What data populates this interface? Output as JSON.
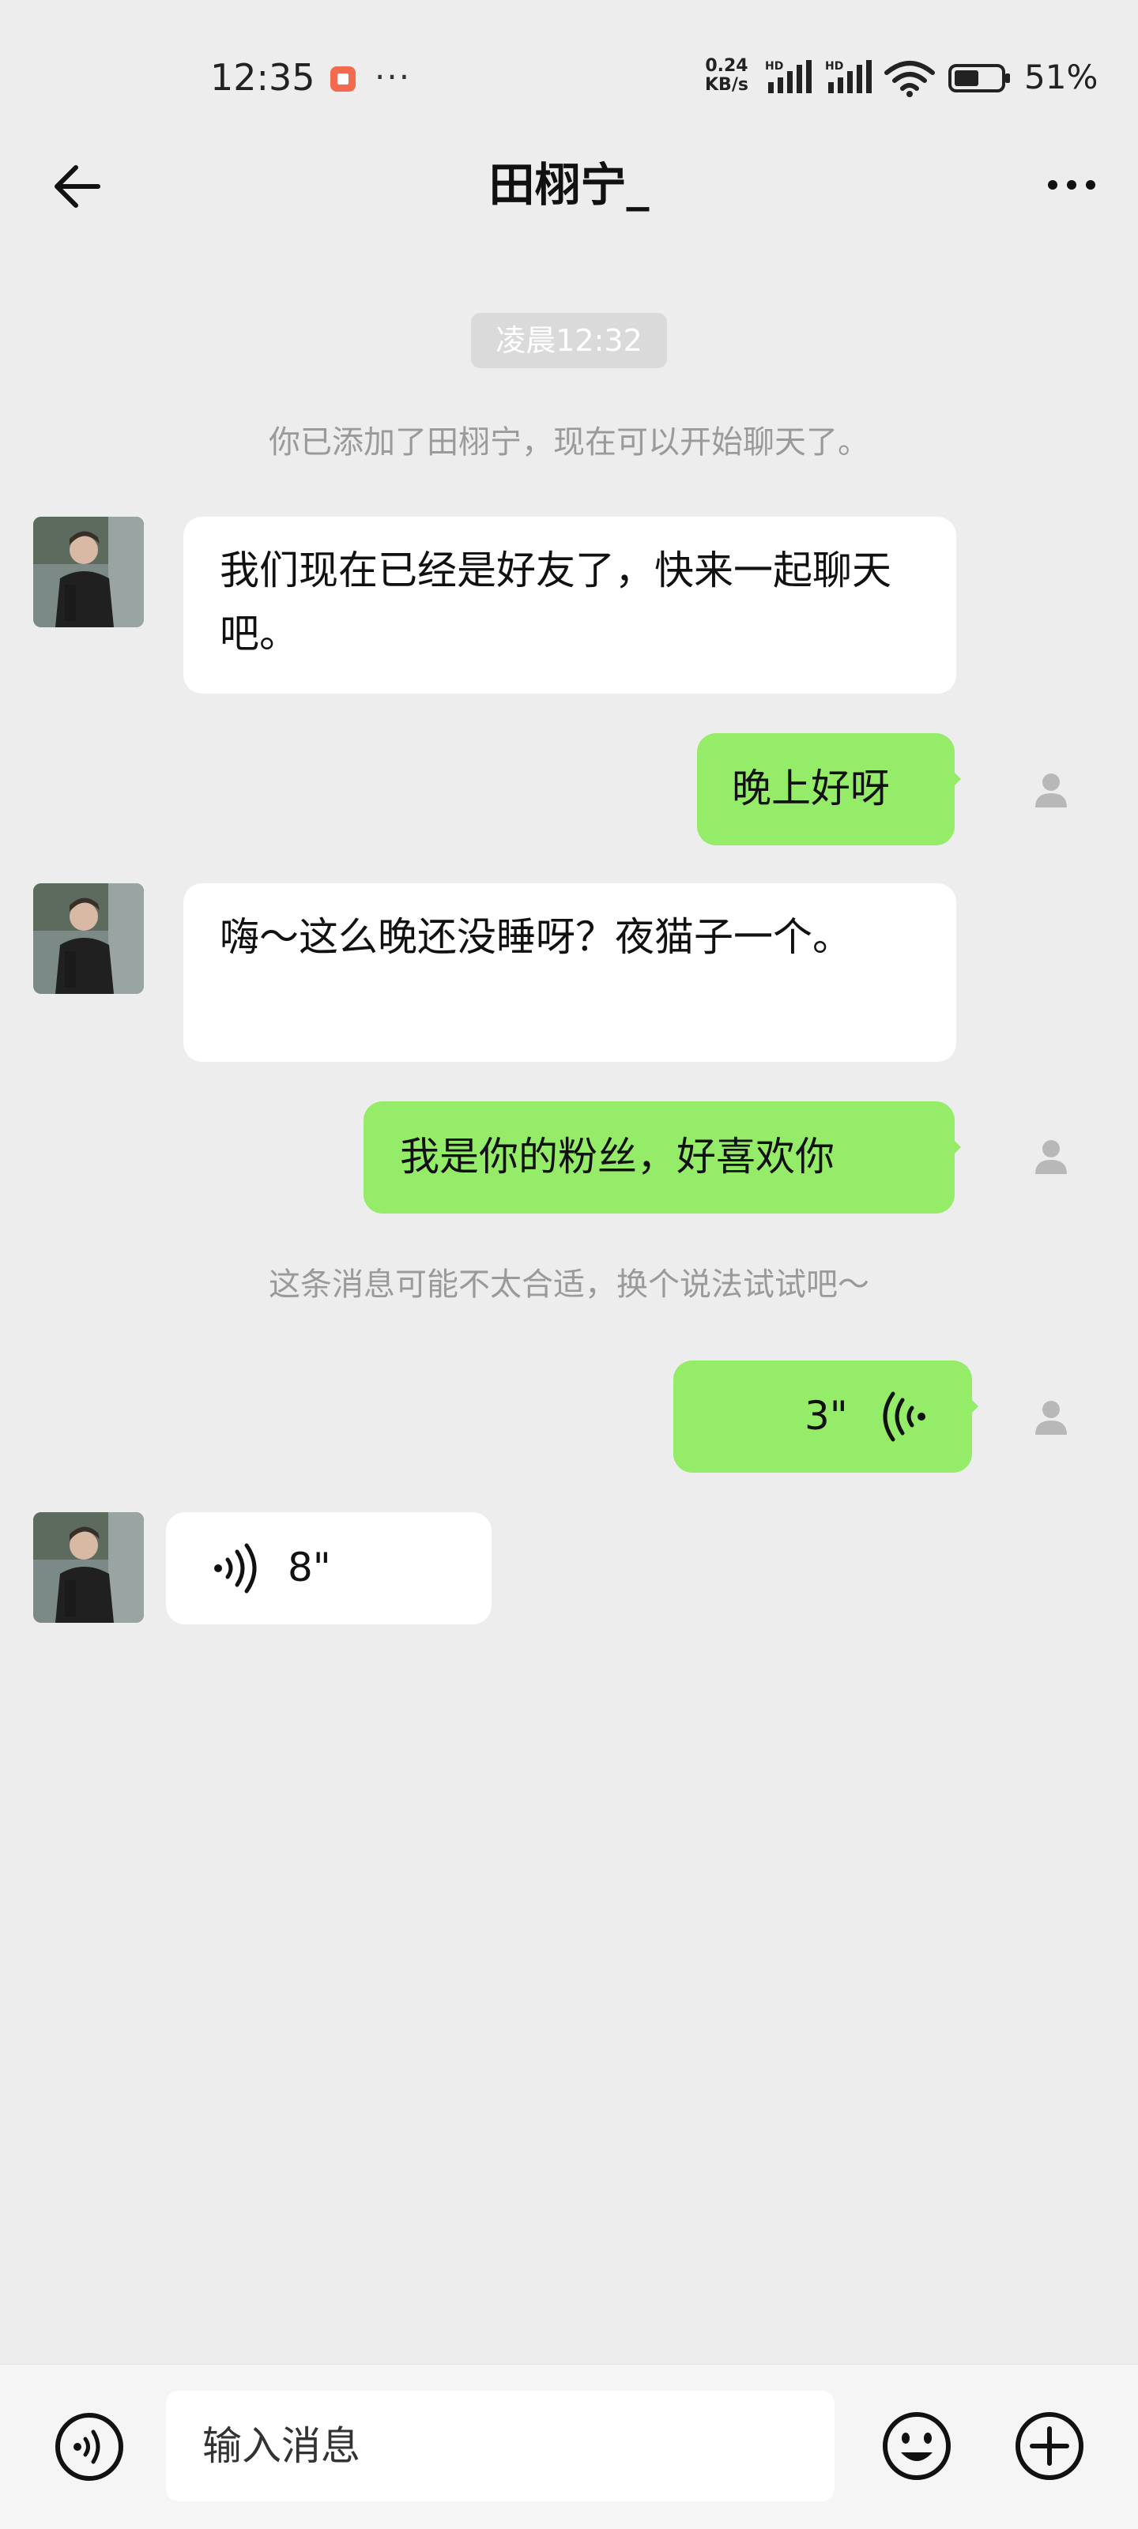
{
  "status_bar": {
    "time": "12:35",
    "dots": "···",
    "net_speed_value": "0.24",
    "net_speed_unit": "KB/s",
    "battery": "51%"
  },
  "header": {
    "title": "田栩宁_"
  },
  "chat": {
    "time_divider": "凌晨12:32",
    "system_added": "你已添加了田栩宁，现在可以开始聊天了。",
    "messages": [
      {
        "side": "left",
        "text": "我们现在已经是好友了，快来一起聊天吧。"
      },
      {
        "side": "right",
        "text": "晚上好呀"
      },
      {
        "side": "left",
        "text": "嗨～这么晚还没睡呀？夜猫子一个。"
      },
      {
        "side": "right",
        "text": "我是你的粉丝，好喜欢你"
      },
      {
        "side": "right",
        "voice_duration": "3\""
      },
      {
        "side": "left",
        "voice_duration": "8\""
      }
    ],
    "system_warning": "这条消息可能不太合适，换个说法试试吧～"
  },
  "input": {
    "placeholder": "输入消息"
  },
  "colors": {
    "background": "#ededed",
    "bubble_self": "#95ec69",
    "bubble_other": "#ffffff",
    "system_text": "#9a9a9a"
  },
  "icons": {
    "back": "arrow-left-icon",
    "menu": "more-horizontal-icon",
    "voice_toggle": "voice-icon",
    "emoji": "smiley-icon",
    "plus": "plus-circle-icon"
  }
}
